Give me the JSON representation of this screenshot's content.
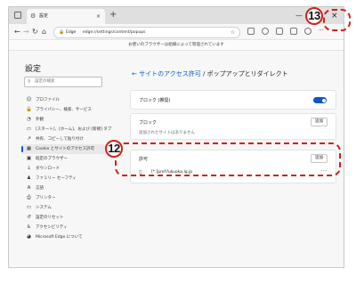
{
  "browser": {
    "tab_title": "設定",
    "address_brand": "Edge",
    "address_url": "edge://settings/content/popups",
    "info_bar": "お使いのブラウザーは組織によって管理されています",
    "icons": {
      "tab_gear": "⚙",
      "tab_close": "×",
      "new_tab": "+",
      "back": "←",
      "forward": "→",
      "refresh": "↻",
      "home": "⌂",
      "lock": "🔒",
      "favorite": "☆",
      "minimize": "—",
      "maximize": "□",
      "close": "×"
    }
  },
  "sidebar": {
    "title": "設定",
    "search_placeholder": "設定の検索",
    "search_icon": "⚲",
    "items": [
      {
        "icon": "☺",
        "label": "プロファイル"
      },
      {
        "icon": "🔒",
        "label": "プライバシー、検索、サービス"
      },
      {
        "icon": "◔",
        "label": "外観"
      },
      {
        "icon": "▭",
        "label": "[スタート]、[ホーム]、および [新規] タブ"
      },
      {
        "icon": "↗",
        "label": "共有、コピーして貼り付け"
      },
      {
        "icon": "▦",
        "label": "Cookie とサイトのアクセス許可"
      },
      {
        "icon": "▣",
        "label": "既定のブラウザー"
      },
      {
        "icon": "↓",
        "label": "ダウンロード"
      },
      {
        "icon": "♟",
        "label": "ファミリー セーフティ"
      },
      {
        "icon": "A",
        "label": "言語"
      },
      {
        "icon": "⎙",
        "label": "プリンター"
      },
      {
        "icon": "▭",
        "label": "システム"
      },
      {
        "icon": "↺",
        "label": "設定のリセット"
      },
      {
        "icon": "♿",
        "label": "アクセシビリティ"
      },
      {
        "icon": "◕",
        "label": "Microsoft Edge について"
      }
    ]
  },
  "main": {
    "back_icon": "←",
    "breadcrumb_link": "サイトのアクセス許可",
    "breadcrumb_sep": " / ",
    "breadcrumb_current": "ポップアップとリダイレクト",
    "block_recommended": {
      "label": "ブロック (推奨)",
      "enabled": true
    },
    "block_section": {
      "label": "ブロック",
      "add_label": "追加",
      "empty_text": "追加されたサイトはありません"
    },
    "allow_section": {
      "label": "許可",
      "add_label": "追加",
      "sites": [
        {
          "icon": "▯",
          "site": "[*.]pref.fukuoka.lg.jp",
          "more": "···"
        }
      ]
    }
  },
  "annotations": {
    "marker_12": "12",
    "marker_13": "13",
    "accent_color": "#d1221a"
  }
}
